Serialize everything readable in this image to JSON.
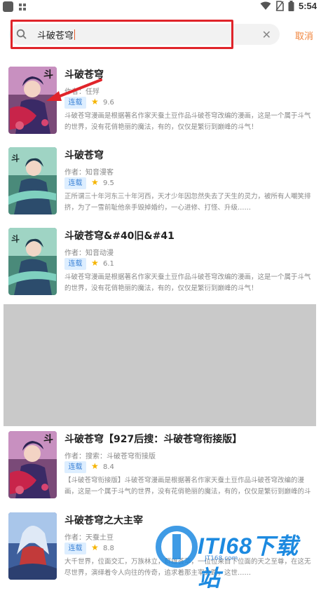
{
  "status_bar": {
    "time": "5:54"
  },
  "search": {
    "query": "斗破苍穹",
    "cancel_label": "取消"
  },
  "results": [
    {
      "title": "斗破苍穹",
      "author": "作者：任殍",
      "status": "连载",
      "rating": "9.6",
      "desc": "斗破苍穹漫画是根据著名作家天蚕土豆作品斗破苍穹改编的漫画，这是一个属于斗气的世界，没有花俏艳丽的魔法，有的，仅仅是繁衍到巅峰的斗气！",
      "cover": "cover-art"
    },
    {
      "title": "斗破苍穹",
      "author": "作者：知音漫客",
      "status": "连载",
      "rating": "9.5",
      "desc": "正所谓三十年河东三十年河西，天才少年因忽然失去了天生的灵力，被所有人嘲笑排挤，为了一雪前耻他亲手毁掉婚约，一心进修、打怪、升级……",
      "cover": "cover-art"
    },
    {
      "title": "斗破苍穹&#40旧&#41",
      "author": "作者：知音动漫",
      "status": "连载",
      "rating": "6.1",
      "desc": "斗破苍穹漫画是根据著名作家天蚕土豆作品斗破苍穹改编的漫画，这是一个属于斗气的世界，没有花俏艳丽的魔法，有的，仅仅是繁衍到巅峰的斗气！",
      "cover": "cover-art"
    },
    {
      "title": "斗破苍穹【927后搜：斗破苍穹衔接版】",
      "author": "作者：搜索：斗破苍穹衔接版",
      "status": "连载",
      "rating": "8.4",
      "desc": "【斗破苍穹衔接版】斗破苍穹漫画是根据著名作家天蚕土豆作品斗破苍穹改编的漫画，这是一个属于斗气的世界，没有花俏艳丽的魔法，有的，仅仅是繁衍到巅峰的斗气！",
      "cover": "cover-art"
    },
    {
      "title": "斗破苍穹之大主宰",
      "author": "作者：天蚕土豆",
      "status": "连载",
      "rating": "8.8",
      "desc": "大千世界，位面交汇，万族林立，群雄荟萃，一位位来自下位面的天之至尊，在这无尽世界，演绎着令人向往的传奇，追求着那主宰之路，这世……",
      "cover": "cover-art"
    }
  ],
  "watermark": {
    "brand": "ITI68下载站",
    "url": "JT168.com"
  }
}
